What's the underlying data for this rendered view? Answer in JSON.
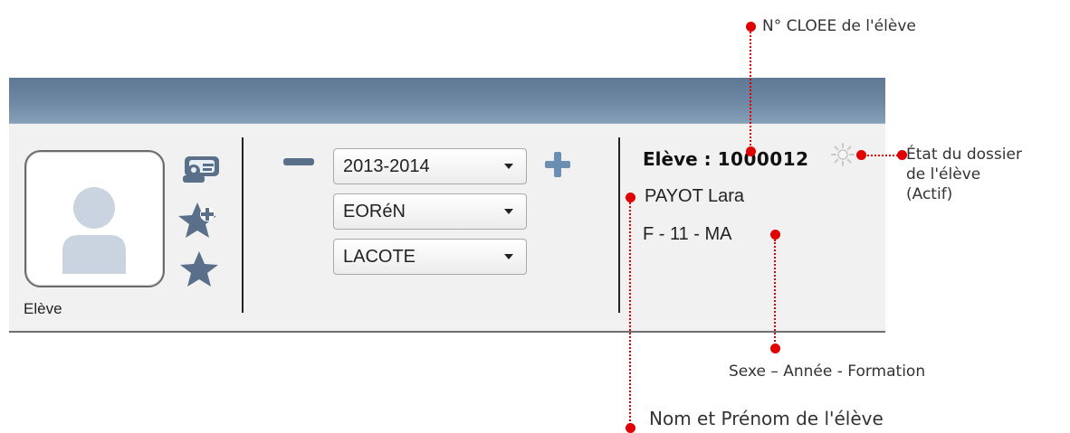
{
  "student_panel": {
    "photo_label": "Elève",
    "year_value": "2013-2014",
    "class_value": "EORéN",
    "teacher_value": "LACOTE",
    "student_title_prefix": "Elève : ",
    "student_id": "1000012",
    "student_name": "PAYOT Lara",
    "student_details": "F - 11 - MA",
    "status": "Actif"
  },
  "annotations": {
    "id_label": "N° CLOEE de l'élève",
    "status_label": [
      "État du dossier",
      "de l'élève",
      "(Actif)"
    ],
    "details_label": "Sexe – Année - Formation",
    "name_label": "Nom et Prénom de l'élève"
  },
  "colors": {
    "titlebar": "#6f88a3",
    "toolbar": "#f1f1f1",
    "icon_blue": "#5a6f8a",
    "plus_blue": "#6b8fb3",
    "annotation_red": "#e00000"
  },
  "icons": [
    "user-placeholder-icon",
    "card-icon",
    "star-add-icon",
    "star-icon",
    "minus-icon",
    "plus-icon",
    "status-sun-icon"
  ]
}
